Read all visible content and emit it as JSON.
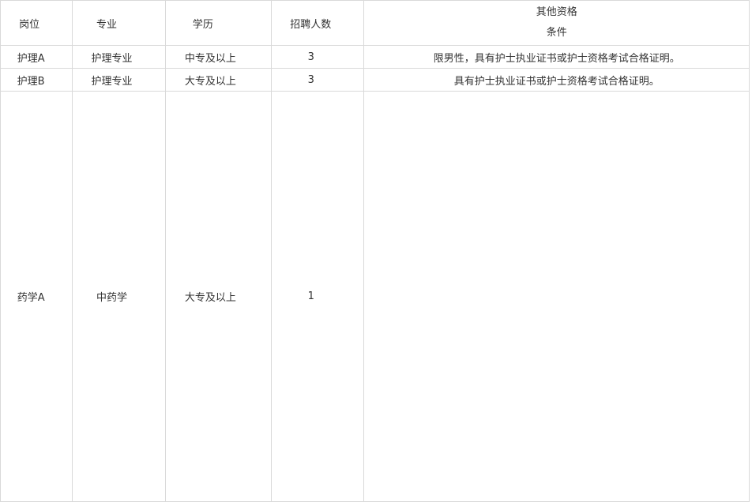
{
  "table": {
    "headers": {
      "position": "岗位",
      "major": "专业",
      "education": "学历",
      "headcount": "招聘人数",
      "other_line1": "其他资格",
      "other_line2": "条件"
    },
    "rows": [
      {
        "position": "护理A",
        "major": "护理专业",
        "education": "中专及以上",
        "headcount": "3",
        "other": "限男性，具有护士执业证书或护士资格考试合格证明。"
      },
      {
        "position": "护理B",
        "major": "护理专业",
        "education": "大专及以上",
        "headcount": "3",
        "other": "具有护士执业证书或护士资格考试合格证明。"
      },
      {
        "position": "药学A",
        "major": "中药学",
        "education": "大专及以上",
        "headcount": "1",
        "other": ""
      }
    ]
  }
}
